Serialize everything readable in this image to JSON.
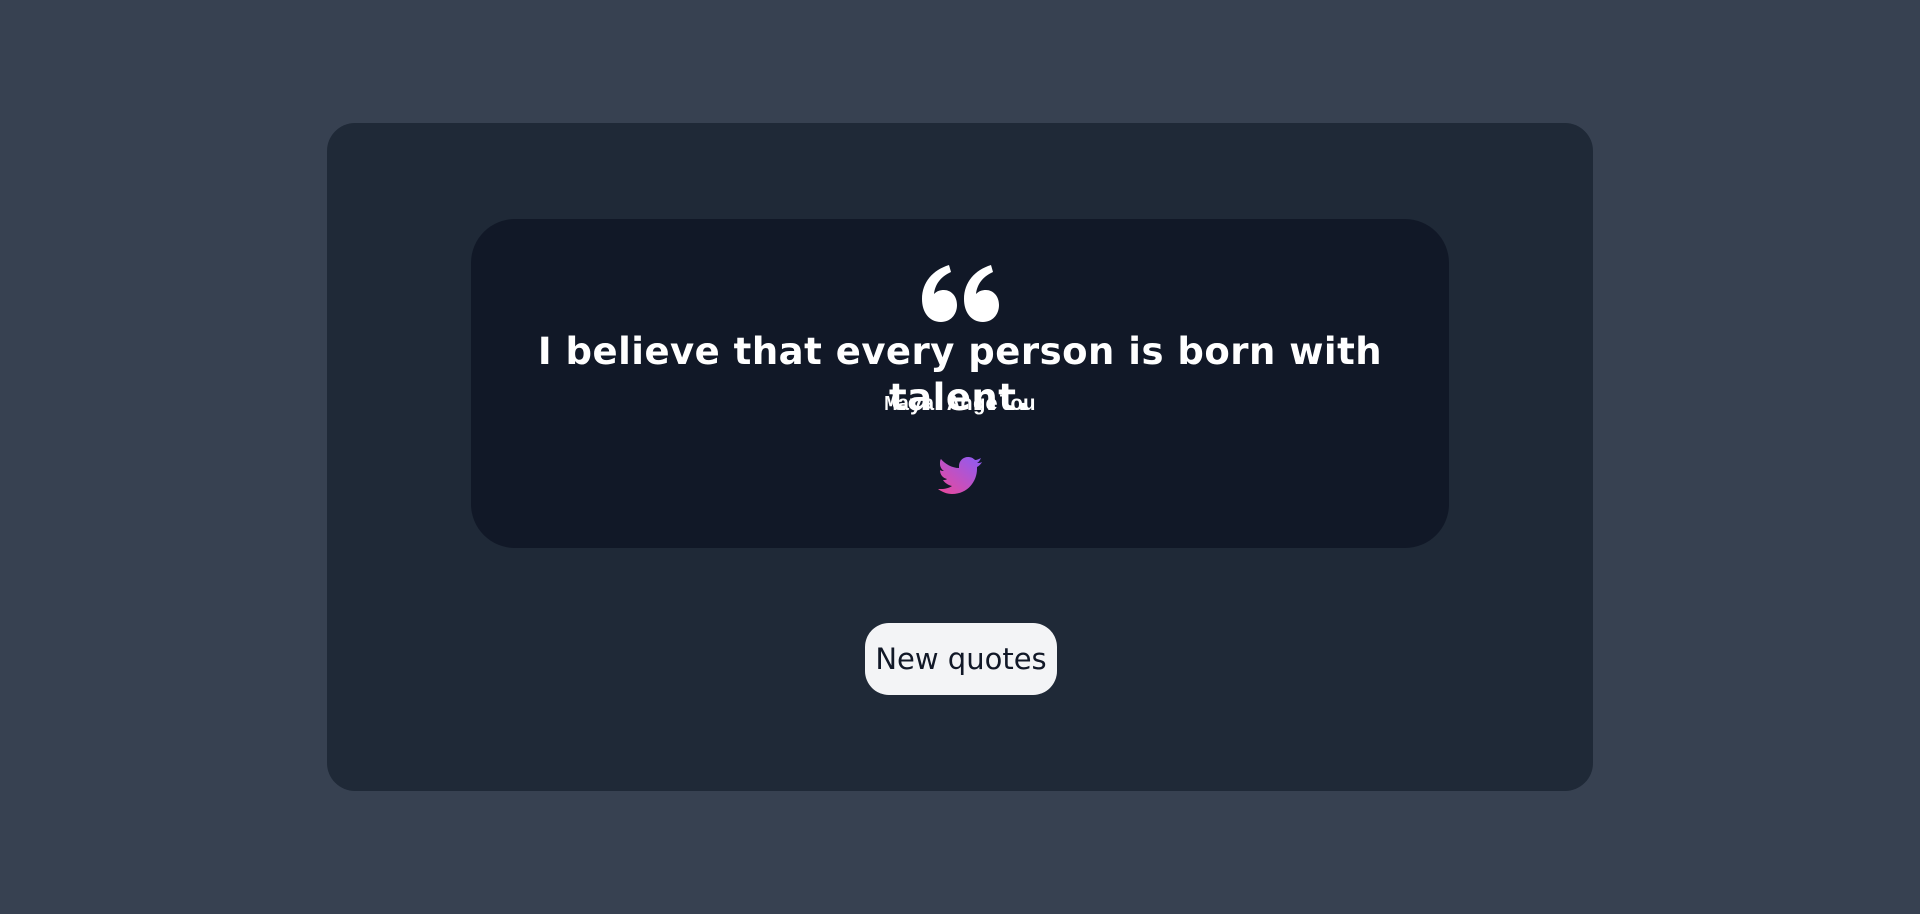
{
  "quote": {
    "text": "I believe that every person is born with talent.",
    "author": "Maya Angelou"
  },
  "icons": {
    "quote": "quote-icon",
    "tweet": "twitter-bird-icon"
  },
  "actions": {
    "new_quote_label": "New quotes"
  },
  "colors": {
    "page_background": "#374151",
    "outer_card": "#1f2937",
    "quote_card": "#111827",
    "text": "#ffffff",
    "button_background": "#f3f4f6",
    "twitter_gradient_start": "#ec4899",
    "twitter_gradient_end": "#8b5cf6"
  }
}
